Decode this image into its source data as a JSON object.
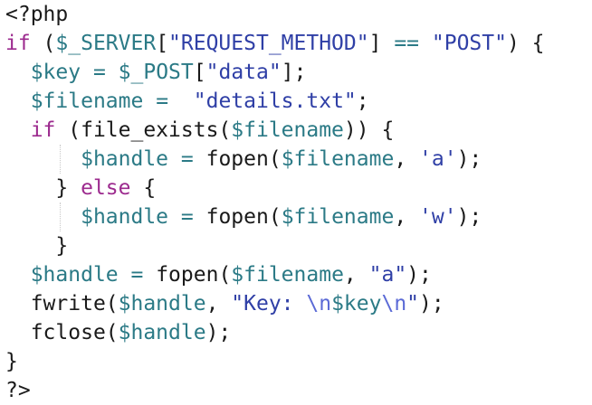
{
  "editor": {
    "colors": {
      "background": "#ffffff",
      "plain": "#1a1a1a",
      "keyword": "#9c2a8e",
      "variable": "#2b7a86",
      "string": "#2f3fa6",
      "escape": "#5b6ad6",
      "operator": "#2b7a86"
    },
    "lines": [
      {
        "indent": "",
        "tokens": [
          {
            "text": "<?php",
            "kind": "plain"
          }
        ]
      },
      {
        "indent": "",
        "tokens": [
          {
            "text": "if",
            "kind": "keyword"
          },
          {
            "text": " (",
            "kind": "plain"
          },
          {
            "text": "$_SERVER",
            "kind": "var"
          },
          {
            "text": "[",
            "kind": "plain"
          },
          {
            "text": "\"REQUEST_METHOD\"",
            "kind": "string"
          },
          {
            "text": "] ",
            "kind": "plain"
          },
          {
            "text": "==",
            "kind": "op"
          },
          {
            "text": " ",
            "kind": "plain"
          },
          {
            "text": "\"POST\"",
            "kind": "string"
          },
          {
            "text": ") {",
            "kind": "plain"
          }
        ]
      },
      {
        "indent": "  ",
        "tokens": [
          {
            "text": "$key",
            "kind": "var"
          },
          {
            "text": " ",
            "kind": "plain"
          },
          {
            "text": "=",
            "kind": "op"
          },
          {
            "text": " ",
            "kind": "plain"
          },
          {
            "text": "$_POST",
            "kind": "var"
          },
          {
            "text": "[",
            "kind": "plain"
          },
          {
            "text": "\"data\"",
            "kind": "string"
          },
          {
            "text": "];",
            "kind": "plain"
          }
        ]
      },
      {
        "indent": "  ",
        "tokens": [
          {
            "text": "$filename",
            "kind": "var"
          },
          {
            "text": " ",
            "kind": "plain"
          },
          {
            "text": "=",
            "kind": "op"
          },
          {
            "text": "  ",
            "kind": "plain"
          },
          {
            "text": "\"details.txt\"",
            "kind": "string"
          },
          {
            "text": ";",
            "kind": "plain"
          }
        ]
      },
      {
        "indent": "  ",
        "tokens": [
          {
            "text": "if",
            "kind": "keyword"
          },
          {
            "text": " (file_exists(",
            "kind": "plain"
          },
          {
            "text": "$filename",
            "kind": "var"
          },
          {
            "text": ")) {",
            "kind": "plain"
          }
        ]
      },
      {
        "indent": "      ",
        "tokens": [
          {
            "text": "$handle",
            "kind": "var"
          },
          {
            "text": " ",
            "kind": "plain"
          },
          {
            "text": "=",
            "kind": "op"
          },
          {
            "text": " fopen(",
            "kind": "plain"
          },
          {
            "text": "$filename",
            "kind": "var"
          },
          {
            "text": ", ",
            "kind": "plain"
          },
          {
            "text": "'a'",
            "kind": "string"
          },
          {
            "text": ");",
            "kind": "plain"
          }
        ]
      },
      {
        "indent": "    ",
        "tokens": [
          {
            "text": "} ",
            "kind": "plain"
          },
          {
            "text": "else",
            "kind": "keyword"
          },
          {
            "text": " {",
            "kind": "plain"
          }
        ]
      },
      {
        "indent": "      ",
        "tokens": [
          {
            "text": "$handle",
            "kind": "var"
          },
          {
            "text": " ",
            "kind": "plain"
          },
          {
            "text": "=",
            "kind": "op"
          },
          {
            "text": " fopen(",
            "kind": "plain"
          },
          {
            "text": "$filename",
            "kind": "var"
          },
          {
            "text": ", ",
            "kind": "plain"
          },
          {
            "text": "'w'",
            "kind": "string"
          },
          {
            "text": ");",
            "kind": "plain"
          }
        ]
      },
      {
        "indent": "    ",
        "tokens": [
          {
            "text": "}",
            "kind": "plain"
          }
        ]
      },
      {
        "indent": "  ",
        "tokens": [
          {
            "text": "$handle",
            "kind": "var"
          },
          {
            "text": " ",
            "kind": "plain"
          },
          {
            "text": "=",
            "kind": "op"
          },
          {
            "text": " fopen(",
            "kind": "plain"
          },
          {
            "text": "$filename",
            "kind": "var"
          },
          {
            "text": ", ",
            "kind": "plain"
          },
          {
            "text": "\"a\"",
            "kind": "string"
          },
          {
            "text": ");",
            "kind": "plain"
          }
        ]
      },
      {
        "indent": "  ",
        "tokens": [
          {
            "text": "fwrite(",
            "kind": "plain"
          },
          {
            "text": "$handle",
            "kind": "var"
          },
          {
            "text": ", ",
            "kind": "plain"
          },
          {
            "text": "\"Key: ",
            "kind": "string"
          },
          {
            "text": "\\n",
            "kind": "escape"
          },
          {
            "text": "$key",
            "kind": "var"
          },
          {
            "text": "\\n",
            "kind": "escape"
          },
          {
            "text": "\"",
            "kind": "string"
          },
          {
            "text": ");",
            "kind": "plain"
          }
        ]
      },
      {
        "indent": "  ",
        "tokens": [
          {
            "text": "fclose(",
            "kind": "plain"
          },
          {
            "text": "$handle",
            "kind": "var"
          },
          {
            "text": ");",
            "kind": "plain"
          }
        ]
      },
      {
        "indent": "",
        "tokens": [
          {
            "text": "}",
            "kind": "plain"
          }
        ]
      },
      {
        "indent": "",
        "tokens": [
          {
            "text": "?>",
            "kind": "plain"
          }
        ]
      }
    ]
  }
}
